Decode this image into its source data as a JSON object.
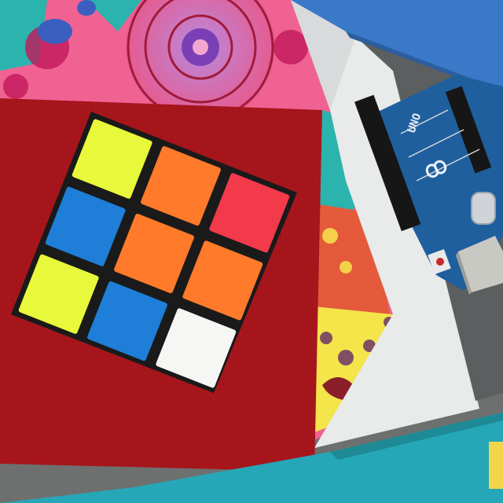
{
  "photo": {
    "board": {
      "brand_text": "UNO",
      "logo_icon": "infinity-icon"
    },
    "cube": {
      "faces": [
        {
          "name": "top-left",
          "color": "#e8f83a"
        },
        {
          "name": "top-middle",
          "color": "#ff7a2a"
        },
        {
          "name": "top-right",
          "color": "#f23a4a"
        },
        {
          "name": "middle-left",
          "color": "#1e7ed8"
        },
        {
          "name": "center",
          "color": "#ff7a2a"
        },
        {
          "name": "middle-right",
          "color": "#ff7a2a"
        },
        {
          "name": "bottom-left",
          "color": "#e8f83a"
        },
        {
          "name": "bottom-middle",
          "color": "#1e7ed8"
        },
        {
          "name": "bottom-right",
          "color": "#f6f6f4"
        }
      ]
    },
    "colors": {
      "red_notebook": "#a8161c",
      "mandala_pink": "#f06292",
      "mandala_teal": "#2bb3ad",
      "paper": "#e9eaea",
      "board_blue": "#1f5f9e",
      "box_blue": "#3a78c8",
      "box_teal": "#26a7b7"
    }
  }
}
